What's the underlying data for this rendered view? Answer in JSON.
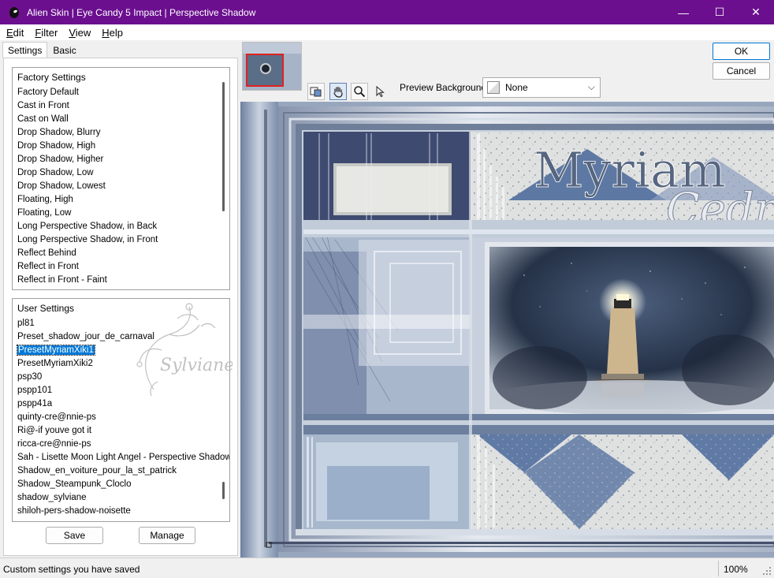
{
  "window": {
    "title": "Alien Skin | Eye Candy 5 Impact | Perspective Shadow",
    "minimize": "—",
    "maximize": "☐",
    "close": "✕"
  },
  "menu": {
    "items": [
      {
        "first": "E",
        "rest": "dit"
      },
      {
        "first": "F",
        "rest": "ilter"
      },
      {
        "first": "V",
        "rest": "iew"
      },
      {
        "first": "H",
        "rest": "elp"
      }
    ]
  },
  "tabs": [
    "Settings",
    "Basic"
  ],
  "factory": {
    "header": "Factory Settings",
    "items": [
      "Factory Default",
      "Cast in Front",
      "Cast on Wall",
      "Drop Shadow, Blurry",
      "Drop Shadow, High",
      "Drop Shadow, Higher",
      "Drop Shadow, Low",
      "Drop Shadow, Lowest",
      "Floating, High",
      "Floating, Low",
      "Long Perspective Shadow, in Back",
      "Long Perspective Shadow, in Front",
      "Reflect Behind",
      "Reflect in Front",
      "Reflect in Front - Faint"
    ]
  },
  "user": {
    "header": "User Settings",
    "items": [
      "pl81",
      "Preset_shadow_jour_de_carnaval",
      "PresetMyriamXiki1",
      "PresetMyriamXiki2",
      "psp30",
      "pspp101",
      "pspp41a",
      "quinty-cre@nnie-ps",
      "Ri@-if youve got it",
      "ricca-cre@nnie-ps",
      "Sah - Lisette Moon Light Angel - Perspective Shadow",
      "Shadow_en_voiture_pour_la_st_patrick",
      "Shadow_Steampunk_Cloclo",
      "shadow_sylviane",
      "shiloh-pers-shadow-noisette"
    ],
    "selected_index": 2
  },
  "buttons": {
    "save": "Save",
    "manage": "Manage",
    "ok": "OK",
    "cancel": "Cancel"
  },
  "preview": {
    "background_label": "Preview Background:",
    "background_value": "None",
    "text_main": "Myriam",
    "text_script": "Cedric"
  },
  "watermark": "Sylviane",
  "status": {
    "text": "Custom settings you have saved",
    "zoom": "100%"
  },
  "colors": {
    "titlebar": "#6b0f8f",
    "selection": "#0078d7",
    "ok_border": "#0078d7"
  }
}
